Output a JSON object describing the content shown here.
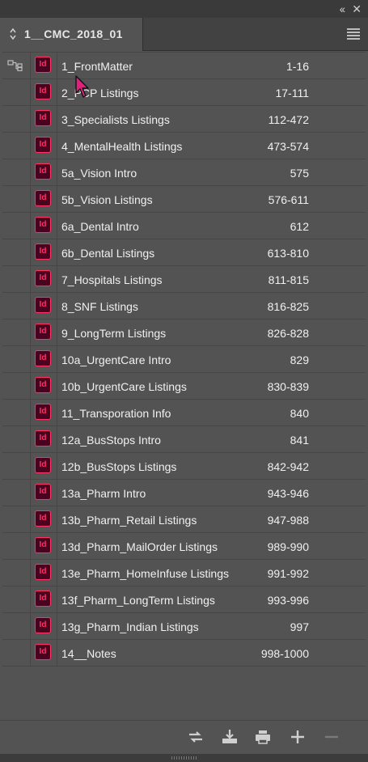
{
  "panel": {
    "tab_title": "1__CMC_2018_01"
  },
  "rows": [
    {
      "name": "1_FrontMatter",
      "pages": "1-16"
    },
    {
      "name": "2_PCP Listings",
      "pages": "17-111"
    },
    {
      "name": "3_Specialists Listings",
      "pages": "112-472"
    },
    {
      "name": "4_MentalHealth Listings",
      "pages": "473-574"
    },
    {
      "name": "5a_Vision Intro",
      "pages": "575"
    },
    {
      "name": "5b_Vision Listings",
      "pages": "576-611"
    },
    {
      "name": "6a_Dental Intro",
      "pages": "612"
    },
    {
      "name": "6b_Dental Listings",
      "pages": "613-810"
    },
    {
      "name": "7_Hospitals Listings",
      "pages": "811-815"
    },
    {
      "name": "8_SNF Listings",
      "pages": "816-825"
    },
    {
      "name": "9_LongTerm Listings",
      "pages": "826-828"
    },
    {
      "name": "10a_UrgentCare Intro",
      "pages": "829"
    },
    {
      "name": "10b_UrgentCare Listings",
      "pages": "830-839"
    },
    {
      "name": "11_Transporation Info",
      "pages": "840"
    },
    {
      "name": "12a_BusStops Intro",
      "pages": "841"
    },
    {
      "name": "12b_BusStops Listings",
      "pages": "842-942"
    },
    {
      "name": "13a_Pharm Intro",
      "pages": "943-946"
    },
    {
      "name": "13b_Pharm_Retail Listings",
      "pages": "947-988"
    },
    {
      "name": "13d_Pharm_MailOrder Listings",
      "pages": "989-990"
    },
    {
      "name": "13e_Pharm_HomeInfuse Listings",
      "pages": "991-992"
    },
    {
      "name": "13f_Pharm_LongTerm Listings",
      "pages": "993-996"
    },
    {
      "name": "13g_Pharm_Indian Listings",
      "pages": "997"
    },
    {
      "name": "14__Notes",
      "pages": "998-1000"
    }
  ],
  "icons": {
    "doc_icon_label": "Id",
    "doc_icon_color": "#ff3366",
    "doc_icon_bg": "#49021f",
    "sync_icon": "style-source-icon",
    "toolbar": [
      "synchronize-icon",
      "add-document-icon",
      "print-icon",
      "add-icon",
      "remove-icon"
    ]
  }
}
